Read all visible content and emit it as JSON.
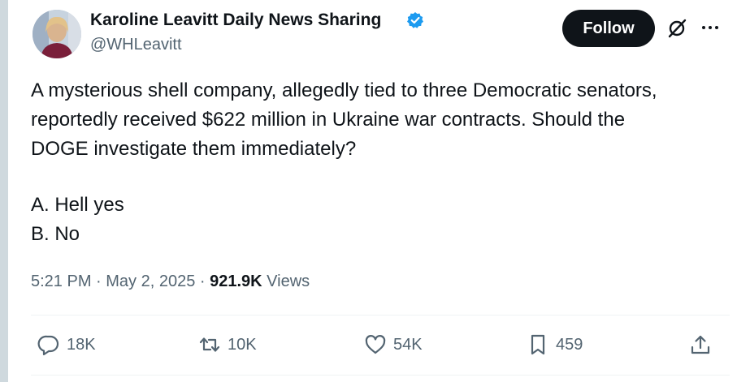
{
  "author": {
    "display_name": "Karoline Leavitt Daily News Sharing",
    "handle": "@WHLeavitt",
    "verified": true
  },
  "follow_label": "Follow",
  "tweet": {
    "lines": [
      "A mysterious shell company, allegedly tied to three Democratic senators,",
      "reportedly received $622 million in Ukraine war contracts. Should the",
      "DOGE investigate them immediately?"
    ],
    "options": [
      "A. Hell yes",
      "B. No"
    ]
  },
  "meta": {
    "time": "5:21 PM",
    "sep1": " · ",
    "date": "May 2, 2025",
    "sep2": " · ",
    "views_count": "921.9K",
    "views_label": " Views"
  },
  "actions": {
    "replies": "18K",
    "reposts": "10K",
    "likes": "54K",
    "bookmarks": "459"
  },
  "colors": {
    "text": "#0f1419",
    "secondary": "#536471",
    "verified": "#1d9bf0",
    "follow_bg": "#0f1419"
  },
  "icons": [
    "verified-badge-icon",
    "grok-icon",
    "more-icon",
    "reply-icon",
    "repost-icon",
    "like-icon",
    "bookmark-icon",
    "share-icon"
  ]
}
